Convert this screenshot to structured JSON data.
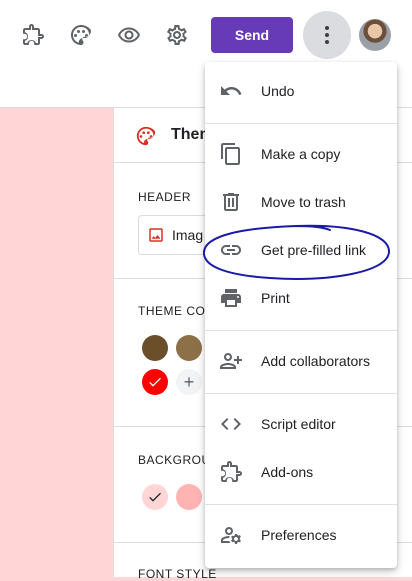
{
  "toolbar": {
    "send_label": "Send",
    "icons": [
      "puzzle-icon",
      "palette-icon",
      "eye-icon",
      "gear-icon",
      "more-vert-icon"
    ]
  },
  "panel": {
    "title": "Them",
    "header_label": "HEADER",
    "image_label": "Imag",
    "theme_color_label": "THEME COL",
    "background_label": "BACKGROUN",
    "font_style_label": "FONT STYLE"
  },
  "colors": {
    "accent": "#673ab7",
    "theme_red": "#ff0000",
    "swatch_brown_dark": "#6b4e2a",
    "swatch_brown_light": "#8c7048",
    "bg_pink_selected": "#ffd5d5",
    "bg_pink": "#ffb3b3",
    "annotation_blue": "#1a1aa6"
  },
  "menu": {
    "items": [
      {
        "label": "Undo",
        "icon": "undo-icon"
      },
      {
        "label": "Make a copy",
        "icon": "copy-icon"
      },
      {
        "label": "Move to trash",
        "icon": "trash-icon"
      },
      {
        "label": "Get pre-filled link",
        "icon": "link-icon"
      },
      {
        "label": "Print",
        "icon": "print-icon"
      },
      {
        "label": "Add collaborators",
        "icon": "add-collaborators-icon"
      },
      {
        "label": "Script editor",
        "icon": "code-icon"
      },
      {
        "label": "Add-ons",
        "icon": "puzzle-icon"
      },
      {
        "label": "Preferences",
        "icon": "preferences-icon"
      }
    ]
  }
}
